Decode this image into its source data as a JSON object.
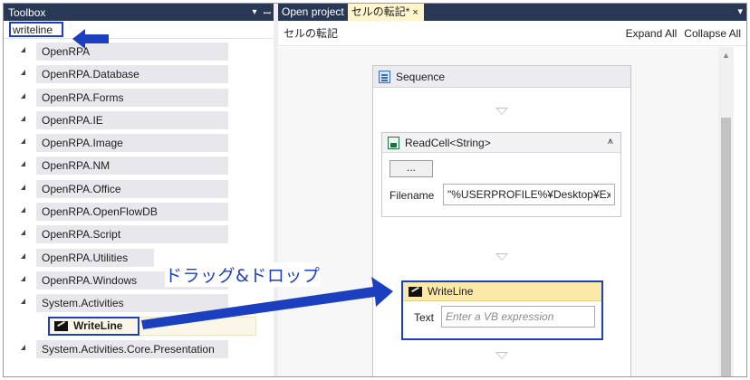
{
  "toolbox": {
    "title": "Toolbox",
    "pin_glyph": "▾",
    "pin2_glyph": "⫡",
    "search_value": "writeline",
    "categories": [
      {
        "label": "OpenRPA"
      },
      {
        "label": "OpenRPA.Database"
      },
      {
        "label": "OpenRPA.Forms"
      },
      {
        "label": "OpenRPA.IE"
      },
      {
        "label": "OpenRPA.Image"
      },
      {
        "label": "OpenRPA.NM"
      },
      {
        "label": "OpenRPA.Office"
      },
      {
        "label": "OpenRPA.OpenFlowDB"
      },
      {
        "label": "OpenRPA.Script"
      },
      {
        "label": "OpenRPA.Utilities"
      },
      {
        "label": "OpenRPA.Windows"
      },
      {
        "label": "System.Activities"
      }
    ],
    "child_item": "WriteLine",
    "last_category": "System.Activities.Core.Presentation"
  },
  "annotation": {
    "drag_drop_label": "ドラッグ&ドロップ",
    "accent_color": "#1c3fbf"
  },
  "tabs": [
    {
      "label": "Open project"
    },
    {
      "label": "セルの転記*"
    }
  ],
  "tab_close_glyph": "×",
  "tab_menu_glyph": "▾",
  "designer": {
    "breadcrumb": "セルの転記",
    "expand_all": "Expand All",
    "collapse_all": "Collapse All",
    "sequence_title": "Sequence",
    "readcell": {
      "title": "ReadCell<String>",
      "collapse_glyph": "⩚",
      "dots_button": "...",
      "filename_label": "Filename",
      "filename_value": "\"%USERPROFILE%¥Desktop¥Exc"
    },
    "writeline": {
      "title": "WriteLine",
      "text_label": "Text",
      "text_placeholder": "Enter a VB expression"
    }
  },
  "colors": {
    "title_bar": "#293955",
    "active_tab": "#fff5cc",
    "writeline_header": "#fbe9a8"
  }
}
